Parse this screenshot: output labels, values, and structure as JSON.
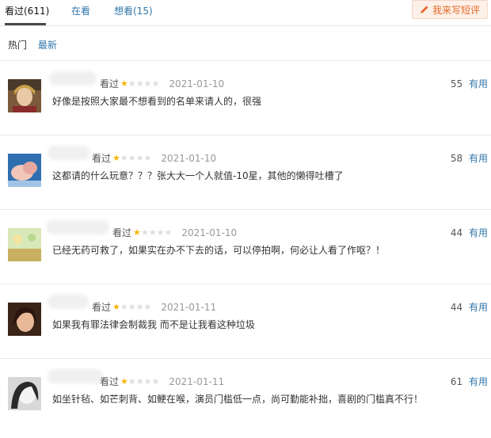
{
  "tabs": [
    {
      "label": "看过(611)"
    },
    {
      "label": "在看"
    },
    {
      "label": "想看(15)"
    }
  ],
  "write_button": {
    "label": "我来写短评",
    "icon": "pencil-icon"
  },
  "sort": {
    "hot": "热门",
    "latest": "最新"
  },
  "comments": [
    {
      "status": "看过",
      "rating": 1,
      "max_rating": 5,
      "date": "2021-01-10",
      "votes": "55",
      "useful_label": "有用",
      "text": "好像是按照大家最不想看到的名单来请人的，很强"
    },
    {
      "status": "看过",
      "rating": 1,
      "max_rating": 5,
      "date": "2021-01-10",
      "votes": "58",
      "useful_label": "有用",
      "text": "这都请的什么玩意？？？张大大一个人就值-10星，其他的懒得吐槽了"
    },
    {
      "status": "看过",
      "rating": 1,
      "max_rating": 5,
      "date": "2021-01-10",
      "votes": "44",
      "useful_label": "有用",
      "text": "已经无药可救了，如果实在办不下去的话，可以停拍啊，何必让人看了作呕？！"
    },
    {
      "status": "看过",
      "rating": 1,
      "max_rating": 5,
      "date": "2021-01-11",
      "votes": "44",
      "useful_label": "有用",
      "text": "如果我有罪法律会制裁我 而不是让我看这种垃圾"
    },
    {
      "status": "看过",
      "rating": 1,
      "max_rating": 5,
      "date": "2021-01-11",
      "votes": "61",
      "useful_label": "有用",
      "text": "如坐针毡、如芒刺背、如鲠在喉，演员门槛低一点，尚可勤能补拙，喜剧的门槛真不行！"
    }
  ],
  "colors": {
    "link": "#3377aa",
    "star": "#f5b50a",
    "accent": "#e56a2c"
  }
}
